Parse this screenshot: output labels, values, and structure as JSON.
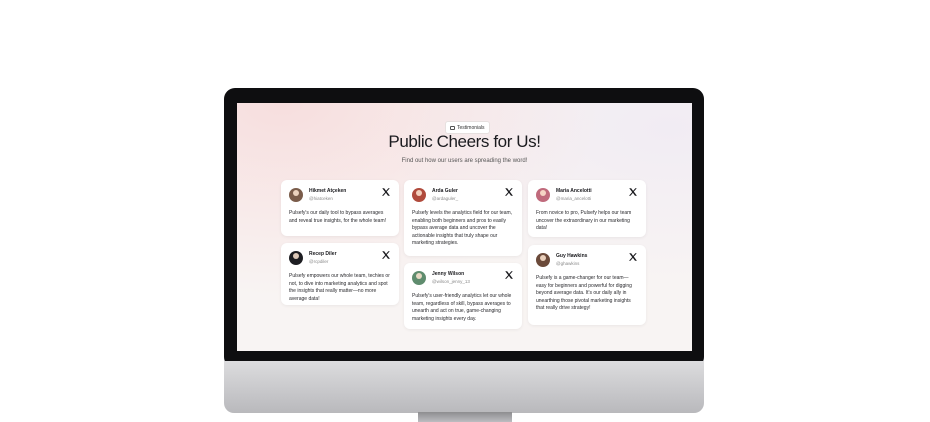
{
  "section": {
    "badge": "Testimonials",
    "title": "Public Cheers for Us!",
    "subtitle": "Find out how our users are spreading the word!"
  },
  "testimonials": [
    {
      "name": "Hikmet Atçeken",
      "handle": "@hiatceken",
      "text": "Pulsefy's our daily tool to bypass averages and reveal true insights, for the whole team!",
      "avatar_color": "#7a5c4a",
      "icon": "x-logo-icon"
    },
    {
      "name": "Recep Diler",
      "handle": "@rcpdiler",
      "text": "Pulsefy empowers our whole team, techies or not, to dive into marketing analytics and spot the insights that really matter—no more average data!",
      "avatar_color": "#1e1e22",
      "icon": "x-logo-icon"
    },
    {
      "name": "Arda Guler",
      "handle": "@ardaguler_",
      "text": "Pulsefy levels the analytics field for our team, enabling both beginners and pros to easily bypass average data and uncover the actionable insights that truly shape our marketing strategies.",
      "avatar_color": "#b04a3c",
      "icon": "x-logo-icon"
    },
    {
      "name": "Jenny Wilson",
      "handle": "@wilson_jenny_13",
      "text": "Pulsefy's user-friendly analytics let our whole team, regardless of skill, bypass averages to unearth and act on true, game-changing marketing insights every day.",
      "avatar_color": "#5f8c6e",
      "icon": "x-logo-icon"
    },
    {
      "name": "Maria Ancelotti",
      "handle": "@maria_ancelotti",
      "text": "From novice to pro, Pulsefy helps our team uncover the extraordinary in our marketing data!",
      "avatar_color": "#c06a7c",
      "icon": "x-logo-icon"
    },
    {
      "name": "Guy Hawkins",
      "handle": "@ghawkins",
      "text": "Pulsefy is a game-changer for our team—easy for beginners and powerful for digging beyond average data. It's our daily ally in unearthing those pivotal marketing insights that really drive strategy!",
      "avatar_color": "#6b4a3a",
      "icon": "x-logo-icon"
    }
  ]
}
